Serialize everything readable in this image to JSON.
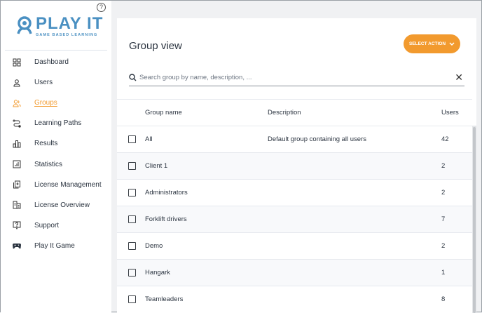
{
  "logo": {
    "title": "PLAY IT",
    "subtitle": "GAME BASED LEARNING"
  },
  "help_icon": "?",
  "sidebar": {
    "items": [
      {
        "label": "Dashboard",
        "icon": "dashboard-icon"
      },
      {
        "label": "Users",
        "icon": "user-icon"
      },
      {
        "label": "Groups",
        "icon": "groups-icon",
        "active": true
      },
      {
        "label": "Learning Paths",
        "icon": "path-icon"
      },
      {
        "label": "Results",
        "icon": "results-icon"
      },
      {
        "label": "Statistics",
        "icon": "statistics-icon"
      },
      {
        "label": "License Management",
        "icon": "license-management-icon"
      },
      {
        "label": "License Overview",
        "icon": "license-overview-icon"
      },
      {
        "label": "Support",
        "icon": "support-icon"
      },
      {
        "label": "Play It Game",
        "icon": "gamepad-icon"
      }
    ]
  },
  "main": {
    "title": "Group view",
    "action_label": "SELECT ACTION",
    "search_placeholder": "Search group by name, description, ...",
    "columns": [
      "Group name",
      "Description",
      "Users"
    ],
    "rows": [
      {
        "name": "All",
        "description": "Default group containing all users",
        "users": "42"
      },
      {
        "name": "Client 1",
        "description": "",
        "users": "2"
      },
      {
        "name": "Administrators",
        "description": "",
        "users": "2"
      },
      {
        "name": "Forklift drivers",
        "description": "",
        "users": "7"
      },
      {
        "name": "Demo",
        "description": "",
        "users": "2"
      },
      {
        "name": "Hangark",
        "description": "",
        "users": "1"
      },
      {
        "name": "Teamleaders",
        "description": "",
        "users": "8"
      }
    ]
  },
  "colors": {
    "accent": "#f29a2e",
    "brand": "#4a90c2"
  }
}
